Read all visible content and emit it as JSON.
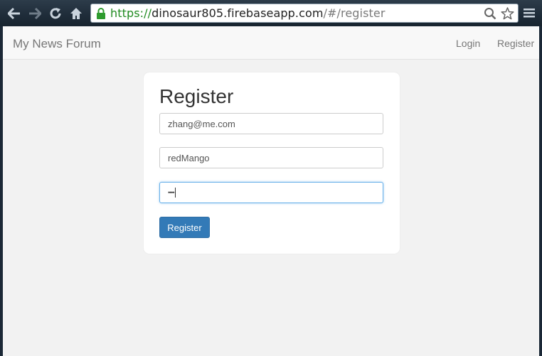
{
  "browser": {
    "url_scheme": "https://",
    "url_host": "dinosaur805.firebaseapp.com",
    "url_path": "/#/register",
    "icons": {
      "back": "back-arrow-icon",
      "forward": "forward-arrow-icon",
      "reload": "reload-icon",
      "home": "home-icon",
      "lock": "lock-icon",
      "search": "search-icon",
      "bookmark": "star-icon",
      "menu": "hamburger-menu-icon"
    },
    "colors": {
      "secure": "#1f8a1f",
      "chrome": "#1f2d3a"
    }
  },
  "navbar": {
    "brand": "My News Forum",
    "links": [
      {
        "label": "Login"
      },
      {
        "label": "Register"
      }
    ]
  },
  "form": {
    "title": "Register",
    "email_value": "zhang@me.com",
    "username_value": "redMango",
    "password_value": "••••",
    "submit_label": "Register",
    "colors": {
      "primary": "#337ab7",
      "focus": "#66afe9"
    }
  }
}
